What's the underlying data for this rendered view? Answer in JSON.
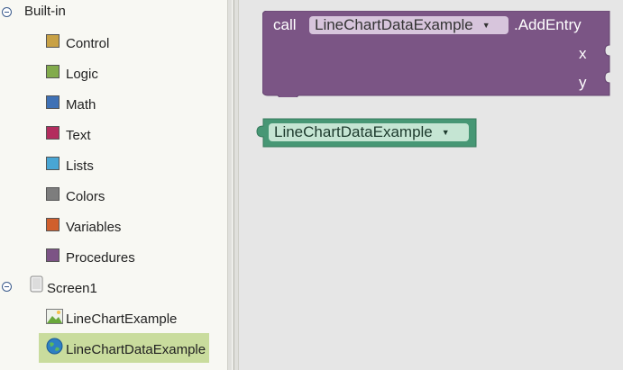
{
  "palette": {
    "builtin_label": "Built-in",
    "categories": [
      {
        "label": "Control",
        "color": "#c8a145"
      },
      {
        "label": "Logic",
        "color": "#82ab4c"
      },
      {
        "label": "Math",
        "color": "#3f71b5"
      },
      {
        "label": "Text",
        "color": "#b32d5e"
      },
      {
        "label": "Lists",
        "color": "#49a6d4"
      },
      {
        "label": "Colors",
        "color": "#7d7d7d"
      },
      {
        "label": "Variables",
        "color": "#d05f2d"
      },
      {
        "label": "Procedures",
        "color": "#7c5385"
      }
    ],
    "screen_label": "Screen1",
    "components": [
      {
        "label": "LineChartExample",
        "icon": "image-icon"
      },
      {
        "label": "LineChartDataExample",
        "icon": "globe-icon",
        "selected": true
      }
    ]
  },
  "workspace": {
    "call_block": {
      "call_label": "call",
      "component": "LineChartDataExample",
      "method": ".AddEntry",
      "params": [
        "x",
        "y"
      ],
      "color": "#7b5585"
    },
    "component_block": {
      "component": "LineChartDataExample",
      "color": "#479775"
    }
  }
}
